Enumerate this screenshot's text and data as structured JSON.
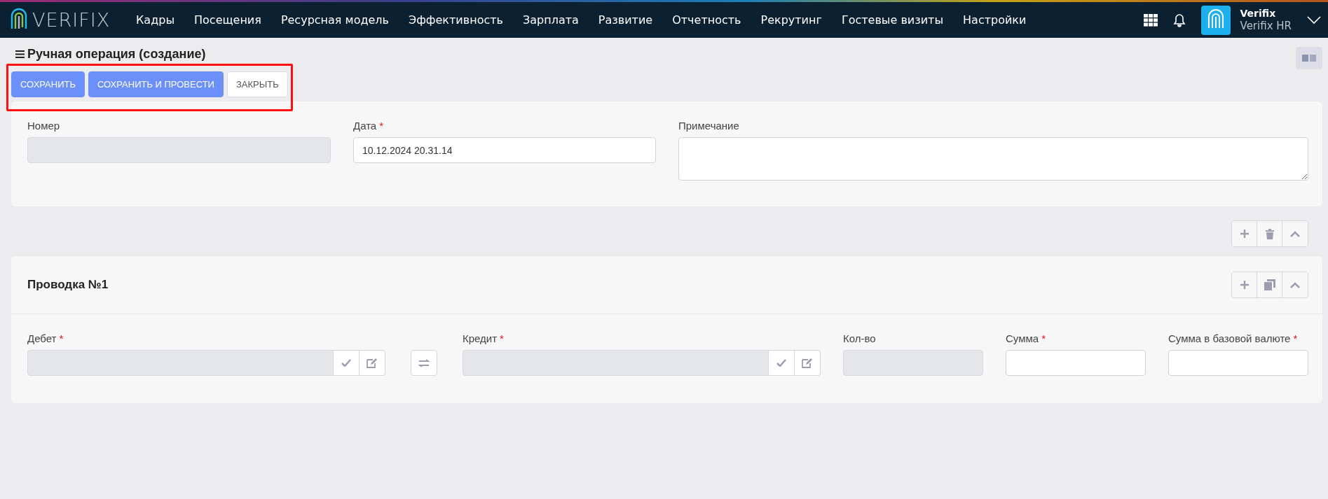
{
  "header": {
    "logo_text": "VERIFIX",
    "nav": [
      {
        "label": "Кадры"
      },
      {
        "label": "Посещения"
      },
      {
        "label": "Ресурсная модель"
      },
      {
        "label": "Эффективность"
      },
      {
        "label": "Зарплата"
      },
      {
        "label": "Развитие"
      },
      {
        "label": "Отчетность"
      },
      {
        "label": "Рекрутинг"
      },
      {
        "label": "Гостевые визиты"
      },
      {
        "label": "Настройки"
      }
    ],
    "user": {
      "name": "Verifix",
      "company": "Verifix HR"
    }
  },
  "page": {
    "title": "Ручная операция (создание)",
    "buttons": [
      {
        "label": "СОХРАНИТЬ",
        "kind": "primary"
      },
      {
        "label": "СОХРАНИТЬ И ПРОВЕСТИ",
        "kind": "primary"
      },
      {
        "label": "ЗАКРЫТЬ",
        "kind": "default"
      }
    ],
    "highlighted": true
  },
  "header_form": {
    "fields": [
      {
        "label": "Номер",
        "disabled": true,
        "kind": "input"
      },
      {
        "label": "Дата",
        "required_mark": "*",
        "disabled": false,
        "kind": "input",
        "value": "10.12.2024 20.31.14"
      },
      {
        "label": "Примечание",
        "disabled": false,
        "kind": "textarea"
      }
    ]
  },
  "entry": {
    "title": "Проводка №1",
    "fields": [
      {
        "label": "Дебет",
        "required_mark": "*",
        "disabled": true,
        "kind": "picker"
      },
      {
        "kind": "swap"
      },
      {
        "label": "Кредит",
        "required_mark": "*",
        "disabled": true,
        "kind": "picker"
      },
      {
        "label": "Кол-во",
        "disabled": true,
        "kind": "input"
      },
      {
        "label": "Сумма",
        "required_mark": "*",
        "disabled": false,
        "kind": "input"
      },
      {
        "label": "Сумма в базовой валюте",
        "required_mark": "*",
        "disabled": false,
        "kind": "input"
      }
    ]
  }
}
